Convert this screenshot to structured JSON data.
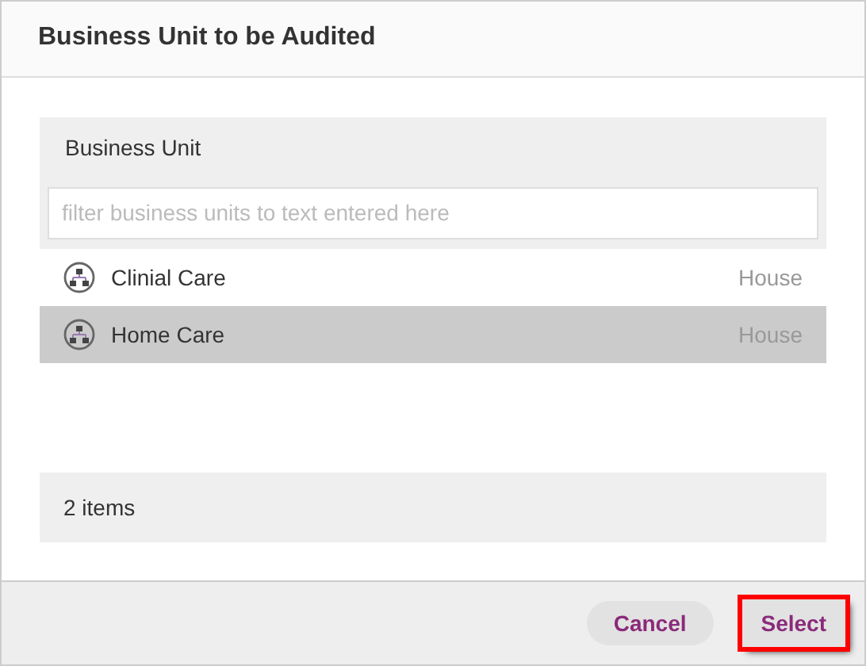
{
  "dialog": {
    "title": "Business Unit to be Audited"
  },
  "list": {
    "header": "Business Unit",
    "filter": {
      "placeholder": "filter business units to text entered here"
    },
    "rows": [
      {
        "name": "Clinial Care",
        "type": "House",
        "selected": false
      },
      {
        "name": "Home Care",
        "type": "House",
        "selected": true
      }
    ],
    "footer": "2 items"
  },
  "buttons": [
    {
      "label": "Cancel",
      "kind": "secondary",
      "highlighted": false
    },
    {
      "label": "Select",
      "kind": "primary",
      "highlighted": true
    }
  ]
}
